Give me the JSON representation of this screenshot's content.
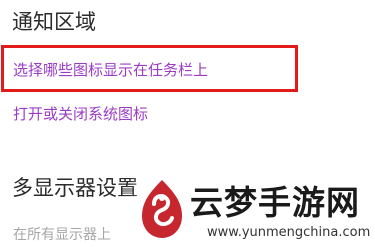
{
  "notification_area": {
    "heading": "通知区域",
    "choose_icons_link": "选择哪些图标显示在任务栏上",
    "toggle_system_icons_link": "打开或关闭系统图标"
  },
  "multiple_displays": {
    "heading": "多显示器设置",
    "show_on_all_displays": "在所有显示器上"
  },
  "watermark": {
    "title": "云梦手游网",
    "url": "www.yunmengchina.com",
    "logo_icon": "yunmeng-logo-icon",
    "brand_color": "#c6262e"
  },
  "highlight_color": "#e21a1a"
}
